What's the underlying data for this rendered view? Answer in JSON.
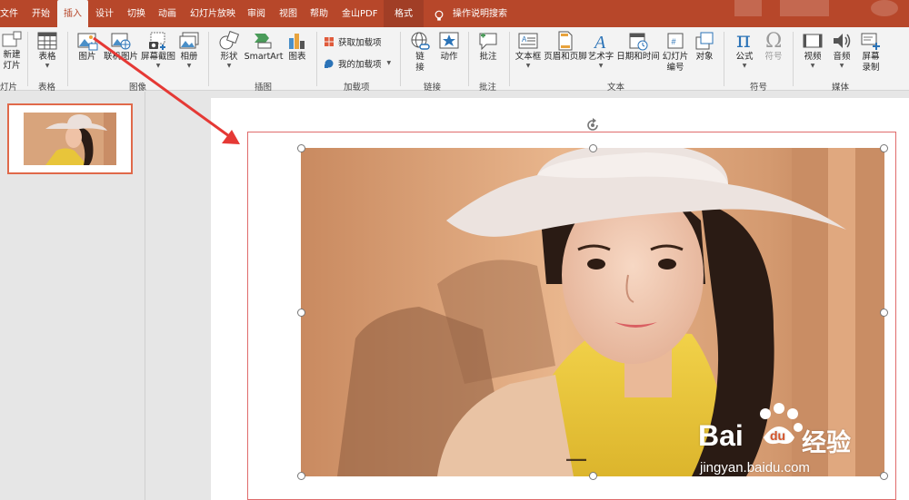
{
  "tabs": {
    "file": "文件",
    "home": "开始",
    "insert": "插入",
    "design": "设计",
    "transitions": "切换",
    "animations": "动画",
    "slideshow": "幻灯片放映",
    "review": "审阅",
    "view": "视图",
    "help": "帮助",
    "wps_pdf": "金山PDF",
    "format": "格式",
    "tell_me": "操作说明搜索"
  },
  "ribbon": {
    "new_slide_line1": "新建",
    "new_slide_line2": "灯片",
    "table": "表格",
    "picture": "图片",
    "online_picture": "联机图片",
    "screenshot": "屏幕截图",
    "album": "相册",
    "shapes": "形状",
    "smartart": "SmartArt",
    "chart": "图表",
    "get_addins": "获取加载项",
    "my_addins": "我的加载项",
    "link_line1": "链",
    "link_line2": "接",
    "action": "动作",
    "comment": "批注",
    "textbox": "文本框",
    "header_footer": "页眉和页脚",
    "wordart": "艺术字",
    "datetime": "日期和时间",
    "slide_number_line1": "幻灯片",
    "slide_number_line2": "编号",
    "object": "对象",
    "equation": "公式",
    "symbol": "符号",
    "video": "视频",
    "audio": "音频",
    "screen_record_line1": "屏幕",
    "screen_record_line2": "录制"
  },
  "groups": {
    "slides": "灯片",
    "tables": "表格",
    "images": "图像",
    "illustrations": "插图",
    "addins": "加载项",
    "links": "链接",
    "comments": "批注",
    "text": "文本",
    "symbols": "符号",
    "media": "媒体"
  },
  "watermark": {
    "brand_prefix": "Bai",
    "brand_suffix": "经验",
    "url": "jingyan.baidu.com"
  },
  "colors": {
    "accent": "#b7472a",
    "selection": "#e06b6b",
    "arrow": "#e53935"
  },
  "icons": [
    "table-icon",
    "picture-icon",
    "online-picture-icon",
    "screenshot-icon",
    "album-icon",
    "shapes-icon",
    "smartart-icon",
    "chart-icon",
    "store-icon",
    "addin-icon",
    "link-icon",
    "action-star-icon",
    "comment-icon",
    "textbox-icon",
    "header-footer-icon",
    "wordart-icon",
    "calendar-icon",
    "slide-number-icon",
    "object-icon",
    "pi-icon",
    "omega-icon",
    "video-icon",
    "audio-icon",
    "screen-record-icon",
    "lightbulb-icon",
    "rotate-icon",
    "paw-icon"
  ]
}
